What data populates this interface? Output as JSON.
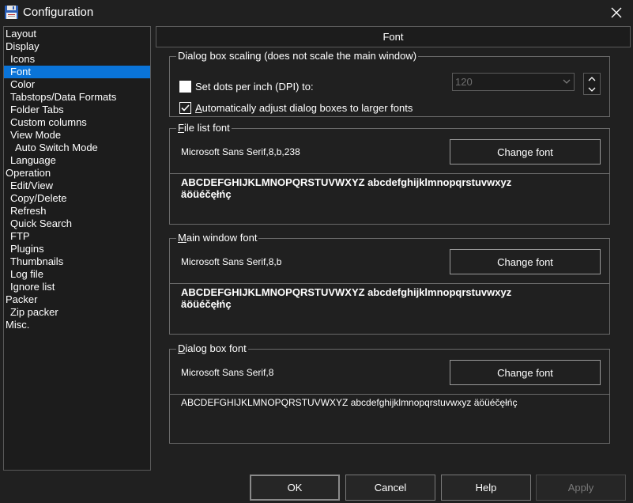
{
  "window": {
    "title": "Configuration"
  },
  "colors": {
    "accent": "#0a74d9",
    "background": "#202020"
  },
  "tree": {
    "items": [
      {
        "label": "Layout",
        "indent": 0
      },
      {
        "label": "Display",
        "indent": 0
      },
      {
        "label": "Icons",
        "indent": 1
      },
      {
        "label": "Font",
        "indent": 1,
        "selected": true
      },
      {
        "label": "Color",
        "indent": 1
      },
      {
        "label": "Tabstops/Data Formats",
        "indent": 1
      },
      {
        "label": "Folder Tabs",
        "indent": 1
      },
      {
        "label": "Custom columns",
        "indent": 1
      },
      {
        "label": "View Mode",
        "indent": 1
      },
      {
        "label": "Auto Switch Mode",
        "indent": 2
      },
      {
        "label": "Language",
        "indent": 1
      },
      {
        "label": "Operation",
        "indent": 0
      },
      {
        "label": "Edit/View",
        "indent": 1
      },
      {
        "label": "Copy/Delete",
        "indent": 1
      },
      {
        "label": "Refresh",
        "indent": 1
      },
      {
        "label": "Quick Search",
        "indent": 1
      },
      {
        "label": "FTP",
        "indent": 1
      },
      {
        "label": "Plugins",
        "indent": 1
      },
      {
        "label": "Thumbnails",
        "indent": 1
      },
      {
        "label": "Log file",
        "indent": 1
      },
      {
        "label": "Ignore list",
        "indent": 1
      },
      {
        "label": "Packer",
        "indent": 0
      },
      {
        "label": "Zip packer",
        "indent": 1
      },
      {
        "label": "Misc.",
        "indent": 0
      }
    ]
  },
  "page": {
    "header": "Font"
  },
  "scaling": {
    "title": "Dialog box scaling (does not scale the main window)",
    "dpi_label": "Set dots per inch (DPI) to:",
    "dpi_checked": false,
    "dpi_value": "120",
    "auto_label": "Automatically adjust dialog boxes to larger fonts",
    "auto_checked": true
  },
  "file_list_font": {
    "title_u": "F",
    "title_rest": "ile list font",
    "desc": "Microsoft Sans Serif,8,b,238",
    "button": "Change font",
    "sample": "ABCDEFGHIJKLMNOPQRSTUVWXYZ abcdefghijklmnopqrstuvwxyz\näöüéčęłńç"
  },
  "main_window_font": {
    "title_u": "M",
    "title_rest": "ain window font",
    "desc": "Microsoft Sans Serif,8,b",
    "button": "Change font",
    "sample": "ABCDEFGHIJKLMNOPQRSTUVWXYZ abcdefghijklmnopqrstuvwxyz\näöüéčęłńç"
  },
  "dialog_box_font": {
    "title_u": "D",
    "title_rest": "ialog box font",
    "desc": "Microsoft Sans Serif,8",
    "button": "Change font",
    "sample": "ABCDEFGHIJKLMNOPQRSTUVWXYZ abcdefghijklmnopqrstuvwxyz äöüéčęłńç"
  },
  "buttons": {
    "ok": "OK",
    "cancel": "Cancel",
    "help": "Help",
    "apply": "Apply"
  }
}
